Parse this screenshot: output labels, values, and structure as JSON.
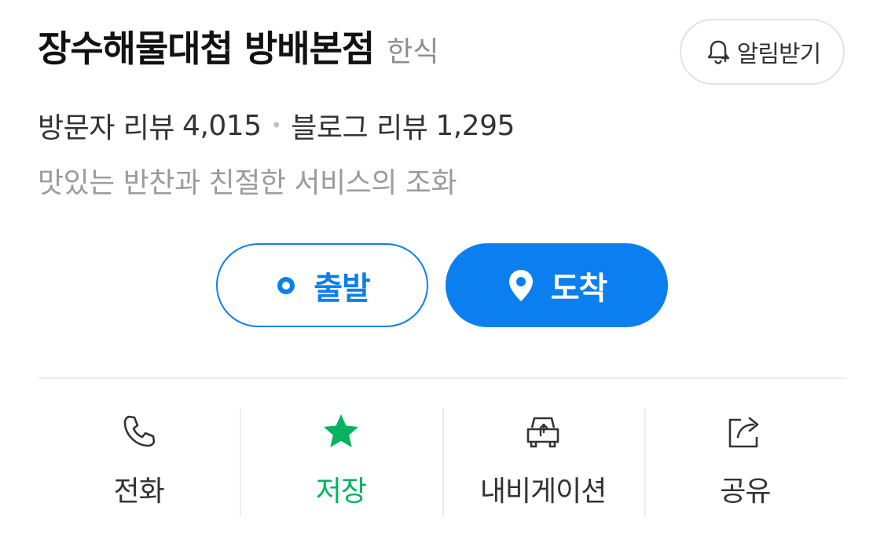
{
  "place": {
    "name": "장수해물대첩 방배본점",
    "category": "한식",
    "alarm_label": "알림받기"
  },
  "reviews": {
    "visitor_label": "방문자 리뷰",
    "visitor_count": "4,015",
    "separator": "•",
    "blog_label": "블로그 리뷰",
    "blog_count": "1,295"
  },
  "description": "맛있는 반찬과 친절한 서비스의 조화",
  "route": {
    "depart_label": "출발",
    "arrive_label": "도착"
  },
  "actions": [
    {
      "label": "전화",
      "icon": "phone-icon"
    },
    {
      "label": "저장",
      "icon": "star-icon"
    },
    {
      "label": "내비게이션",
      "icon": "car-icon"
    },
    {
      "label": "공유",
      "icon": "share-icon"
    }
  ],
  "colors": {
    "accent": "#0b7ff0",
    "saved": "#03b45f",
    "muted": "#9b9b9b"
  }
}
